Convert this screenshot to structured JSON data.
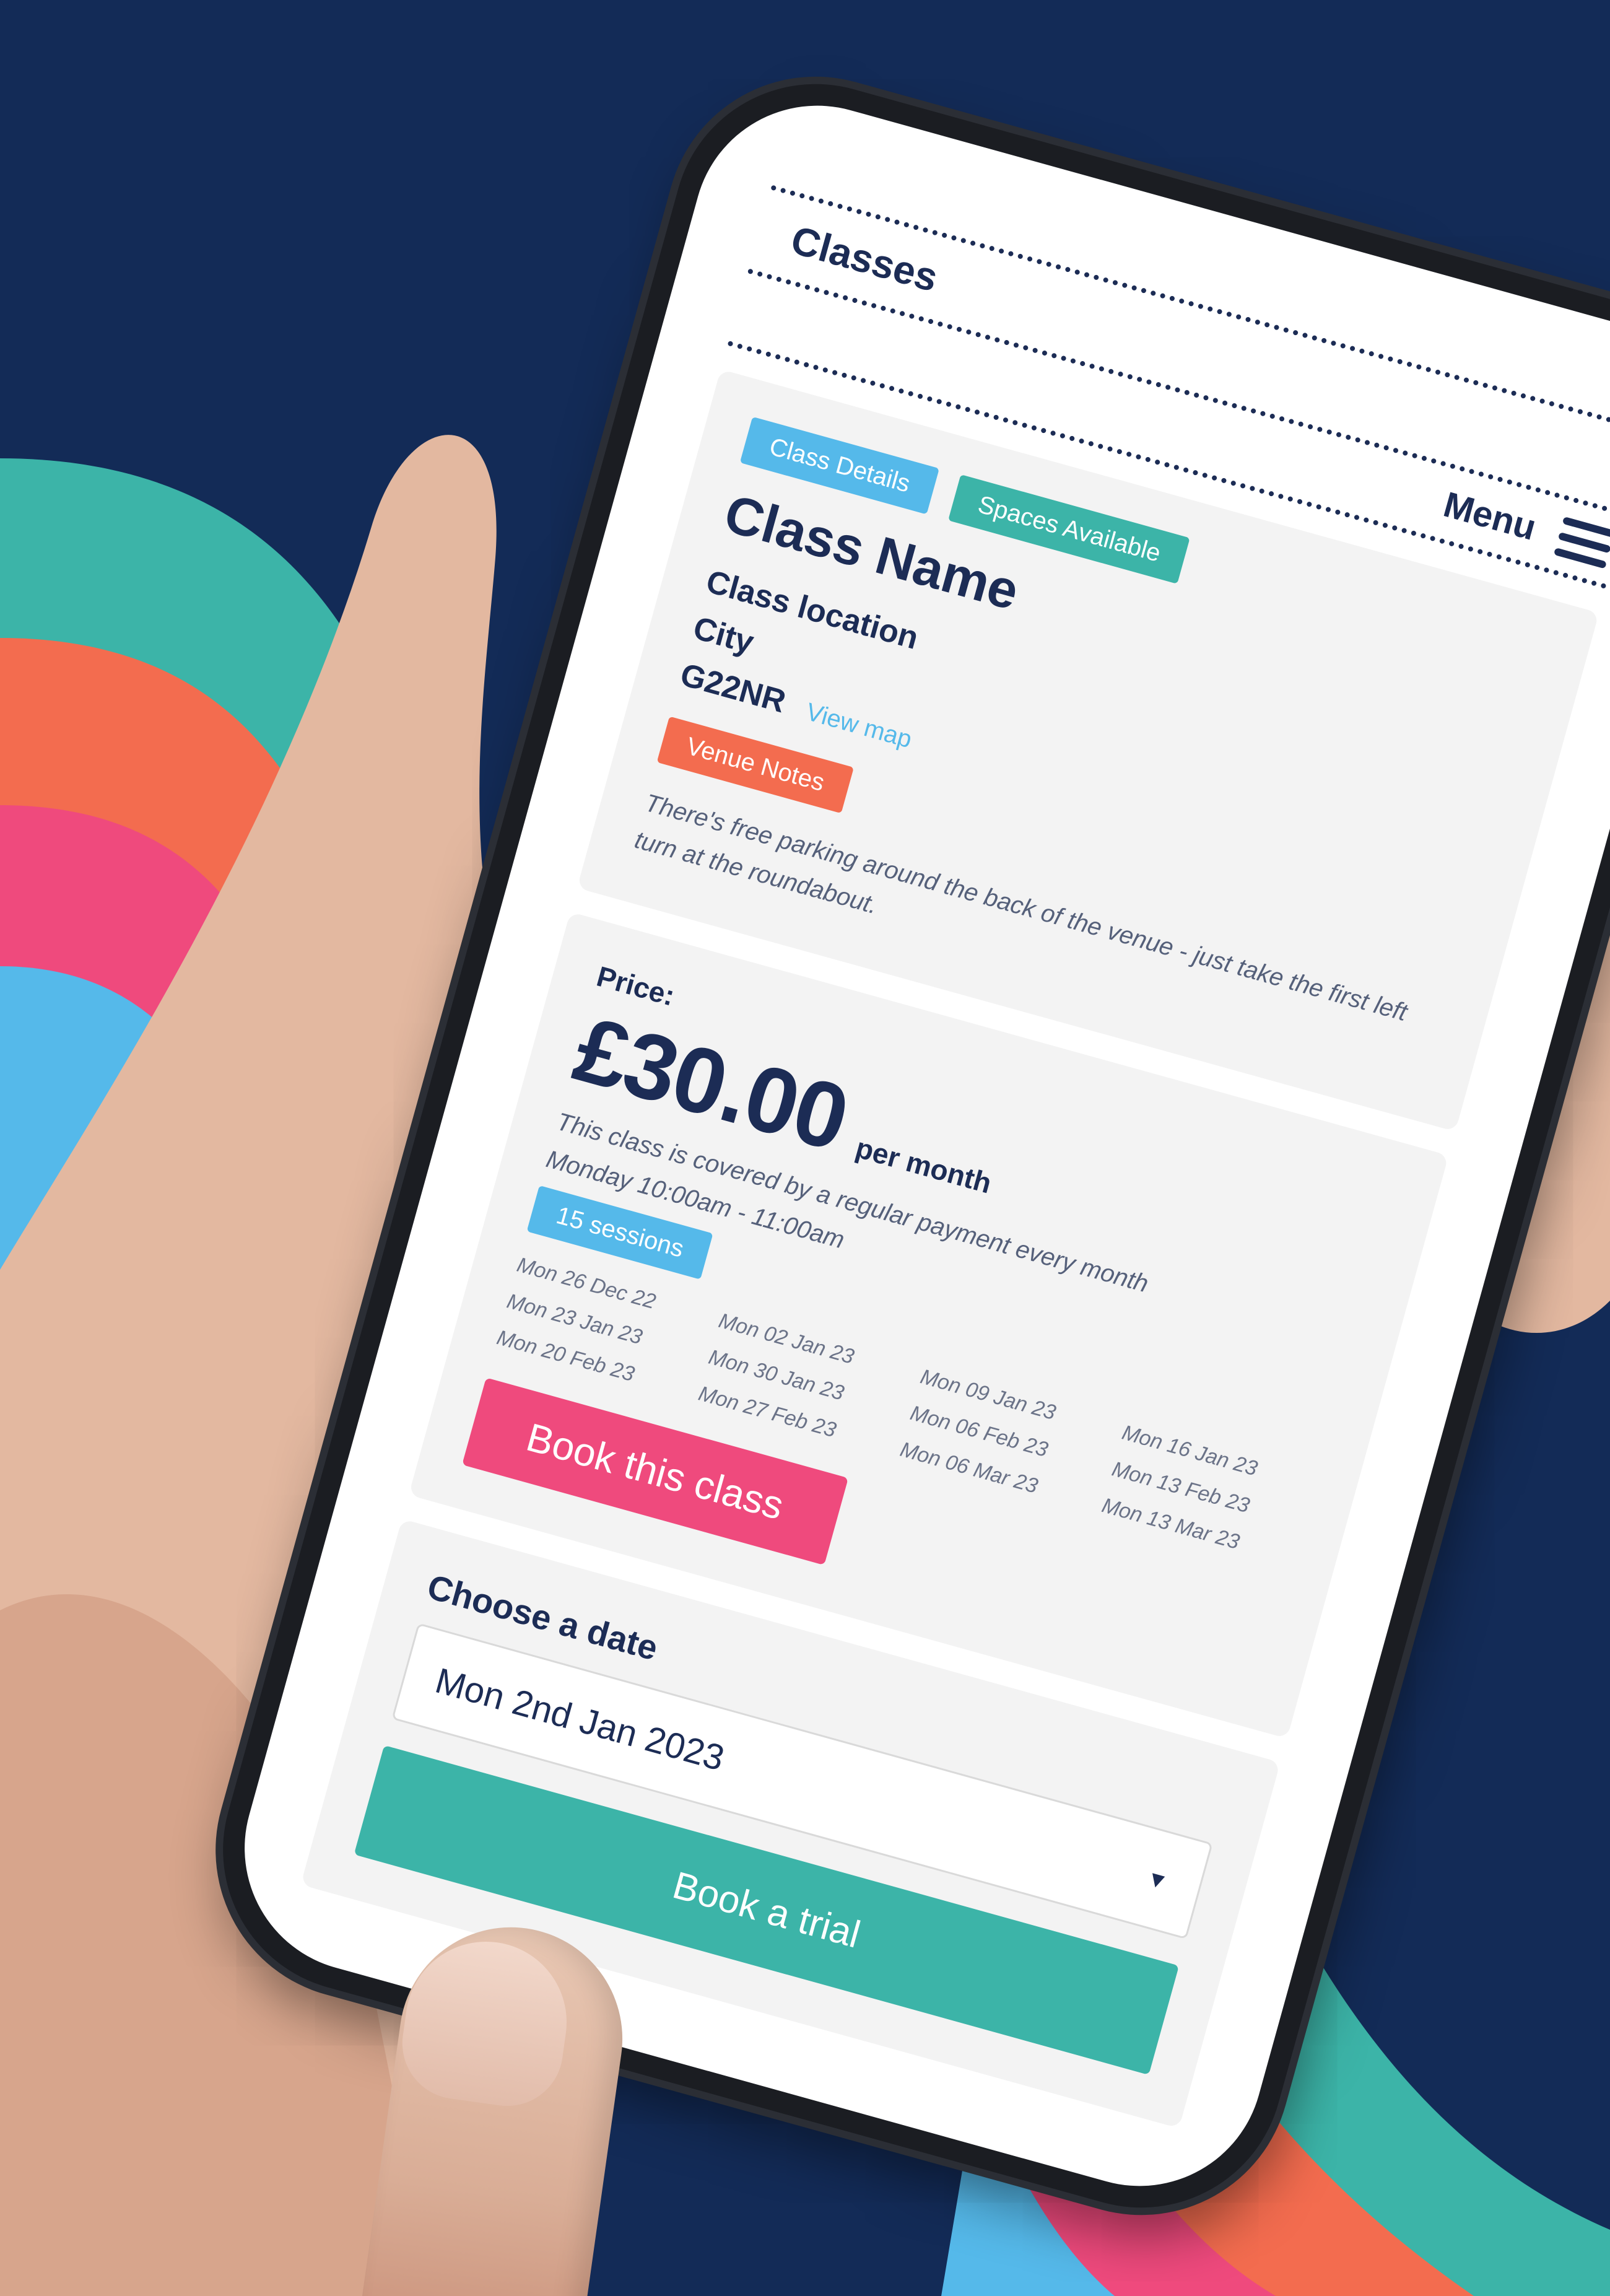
{
  "colors": {
    "background": "#132b57",
    "navy": "#1c2c55",
    "teal": "#3cb4a8",
    "blue": "#55b9ea",
    "orange": "#f36c4f",
    "pink": "#ef4a7d"
  },
  "header": {
    "title": "Classes",
    "menu_label": "Menu",
    "menu_icon": "hamburger-icon"
  },
  "class_card": {
    "details_tag": "Class Details",
    "availability_tag": "Spaces Available",
    "name": "Class Name",
    "location": "Class location",
    "city": "City",
    "postcode": "G22NR",
    "view_map_link": "View map",
    "venue_notes_tag": "Venue Notes",
    "venue_notes_text": "There's free parking around the back of the venue - just take the first left turn at the roundabout."
  },
  "price_card": {
    "label": "Price:",
    "amount": "£30.00",
    "period": "per month",
    "covered_text": "This class is covered by a regular payment every month",
    "schedule": "Monday 10:00am - 11:00am",
    "sessions_tag": "15 sessions",
    "dates": [
      "Mon 26 Dec 22",
      "Mon 02 Jan 23",
      "Mon 09 Jan 23",
      "Mon 16 Jan 23",
      "Mon 23 Jan 23",
      "Mon 30 Jan 23",
      "Mon 06 Feb 23",
      "Mon 13 Feb 23",
      "Mon 20 Feb 23",
      "Mon 27 Feb 23",
      "Mon 06 Mar 23",
      "Mon 13 Mar 23"
    ],
    "book_button": "Book this class"
  },
  "trial_card": {
    "choose_label": "Choose a date",
    "selected_date": "Mon 2nd Jan 2023",
    "dropdown_icon": "caret-down-icon",
    "book_trial_button": "Book a trial"
  }
}
